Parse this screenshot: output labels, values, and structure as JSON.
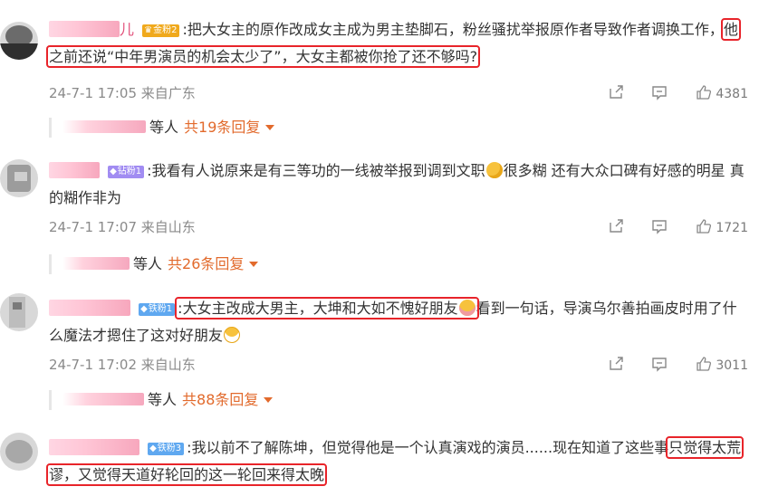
{
  "comments": [
    {
      "name_tail": "儿",
      "badge": "金粉2",
      "text_before": ":把大女主的原作改成女主成为男主垫脚石，粉丝骚扰举报原作者导致作者调换工作，",
      "text_highlight": "他之前还说“中年男演员的机会太少了”，大女主都被你抢了还不够吗?",
      "text_after": "",
      "meta": "24-7-1 17:05 来自广东",
      "likes": "4381",
      "reply_suffix": "等人",
      "reply_count": "共19条回复"
    },
    {
      "name_tail": "",
      "badge": "钻粉1",
      "text_before": ":我看有人说原来是有三等功的一线被举报到调到文职",
      "text_after": "很多糊 还有大众口碑有好感的明星 真的糊作非为",
      "meta": "24-7-1 17:07 来自山东",
      "likes": "1721",
      "reply_suffix": "等人",
      "reply_count": "共26条回复"
    },
    {
      "name_tail": "",
      "badge": "铁粉1",
      "text_highlight": ":大女主改成大男主，大坤和大如不愧好朋友",
      "text_after": "看到一句话，导演乌尔善拍画皮时用了什么魔法才摁住了这对好朋友",
      "meta": "24-7-1 17:02 来自山东",
      "likes": "3011",
      "reply_suffix": "等人",
      "reply_count": "共88条回复"
    },
    {
      "name_tail": "",
      "badge": "铁粉3",
      "text_before": ":我以前不了解陈坤，但觉得他是一个认真演戏的演员......现在知道了这些事",
      "text_highlight": "只觉得太荒谬，又觉得天道好轮回的这一轮回来得太晚"
    }
  ],
  "icons": {
    "share": "share-icon",
    "comment": "comment-icon",
    "like": "thumbs-up-icon"
  },
  "colors": {
    "highlight_box": "#e8242a",
    "reply_count": "#e26a2c",
    "meta_text": "#8a8a8a"
  }
}
